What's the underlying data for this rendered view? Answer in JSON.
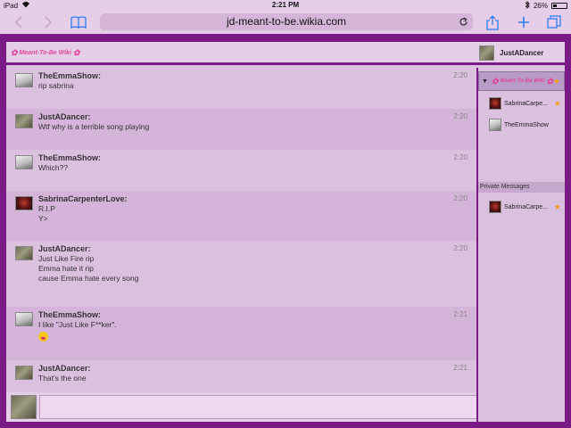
{
  "status_bar": {
    "device": "iPad",
    "time": "2:21 PM",
    "battery": "26%",
    "battery_level": 0.26
  },
  "browser": {
    "url": "jd-meant-to-be.wikia.com"
  },
  "chat": {
    "logo_text": "Meant-To-Be Wiki",
    "current_user": "JustADancer",
    "messages": [
      {
        "user": "TheEmmaShow:",
        "time": "2:20",
        "avatar": "bird",
        "lines": [
          "rip sabrina"
        ]
      },
      {
        "user": "JustADancer:",
        "time": "2:20",
        "avatar": "pug",
        "lines": [
          "Wtf why is a terrible song playing"
        ]
      },
      {
        "user": "TheEmmaShow:",
        "time": "2:20",
        "avatar": "bird",
        "lines": [
          "Which??"
        ]
      },
      {
        "user": "SabrinaCarpenterLove:",
        "time": "2:20",
        "avatar": "dark",
        "lines": [
          "R.I.P",
          "Y>"
        ]
      },
      {
        "user": "JustADancer:",
        "time": "2:20",
        "avatar": "pug",
        "lines": [
          "Just Like Fire rip",
          "Emma hate it rip",
          "cause Emma hate every song"
        ]
      },
      {
        "user": "TheEmmaShow:",
        "time": "2:21",
        "avatar": "bird",
        "lines": [
          "I like \"Just Like F**ker\"."
        ],
        "emoji": true
      },
      {
        "user": "JustADancer:",
        "time": "2:21",
        "avatar": "pug",
        "lines": [
          "That's the one"
        ]
      }
    ]
  },
  "sidebar": {
    "room_logo": "Meant-To-Be Wiki",
    "users": [
      {
        "name": "SabrinaCarpe...",
        "avatar": "dark"
      },
      {
        "name": "TheEmmaShow",
        "avatar": "bird"
      }
    ],
    "private_messages_label": "Private Messages",
    "private_users": [
      {
        "name": "SabrinaCarpe...",
        "avatar": "dark"
      }
    ]
  },
  "colors": {
    "accent": "#2f7bf6",
    "frame": "#7a1a86",
    "panel": "#dcc0e0",
    "logo_pink": "#e0479a"
  }
}
